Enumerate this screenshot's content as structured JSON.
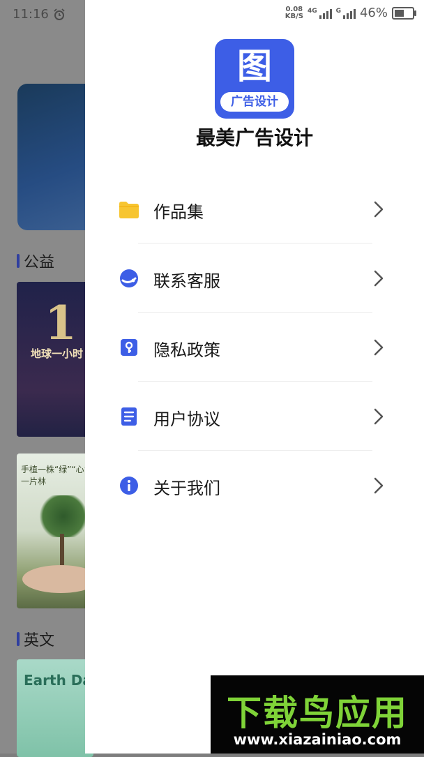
{
  "status_bar": {
    "time": "11:16",
    "net_speed_value": "0.08",
    "net_speed_unit": "KB/S",
    "signal1_label": "4G",
    "signal2_label": "G",
    "battery": "46%"
  },
  "background": {
    "section1": "公益",
    "section2": "英文",
    "card1_number": "1",
    "card1_title": "地球一小时",
    "card2_title": "手植一株“绿”“心”载一片林",
    "card3_title": "Earth Da"
  },
  "drawer": {
    "app_icon_glyph": "图",
    "app_icon_badge": "广告设计",
    "app_name": "最美广告设计",
    "menu": [
      {
        "label": "作品集",
        "icon": "folder-icon"
      },
      {
        "label": "联系客服",
        "icon": "customer-service-icon"
      },
      {
        "label": "隐私政策",
        "icon": "privacy-icon"
      },
      {
        "label": "用户协议",
        "icon": "document-icon"
      },
      {
        "label": "关于我们",
        "icon": "info-icon"
      }
    ]
  },
  "watermark": {
    "title": "下载鸟应用",
    "url": "www.xiazainiao.com"
  },
  "colors": {
    "accent": "#3d5ee6",
    "folder": "#f7c531",
    "watermark_green": "#7fd338"
  }
}
